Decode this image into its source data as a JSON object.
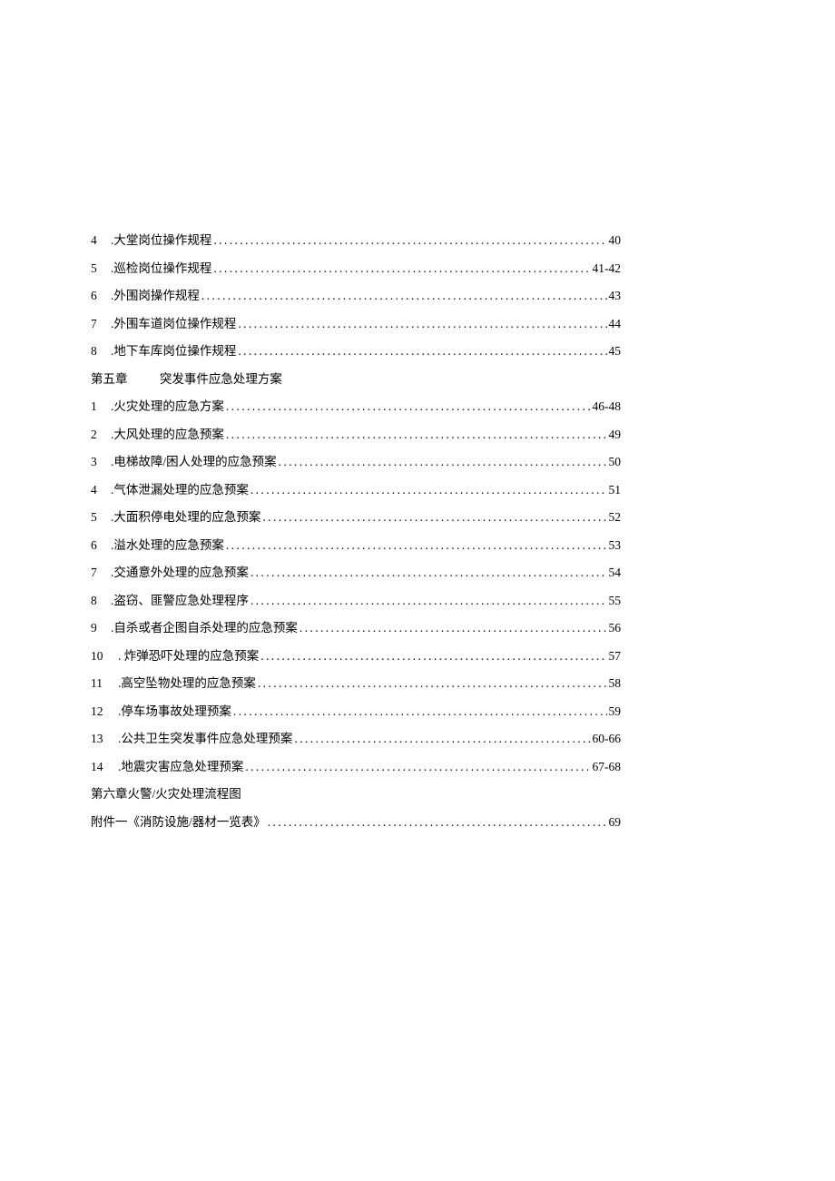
{
  "section_prev": [
    {
      "num": "4",
      "title": ".大堂岗位操作规程",
      "page": "40"
    },
    {
      "num": "5",
      "title": ".巡检岗位操作规程",
      "page": "41-42"
    },
    {
      "num": "6",
      "title": ".外围岗操作规程",
      "page": "43"
    },
    {
      "num": "7",
      "title": ".外围车道岗位操作规程",
      "page": "44"
    },
    {
      "num": "8",
      "title": ".地下车库岗位操作规程",
      "page": "45"
    }
  ],
  "chapter5": {
    "label": "第五章",
    "title": "突发事件应急处理方案",
    "items": [
      {
        "num": "1",
        "title": ".火灾处理的应急方案",
        "page": "46-48"
      },
      {
        "num": "2",
        "title": ".大风处理的应急预案",
        "page": "49"
      },
      {
        "num": "3",
        "title": ".电梯故障/困人处理的应急预案",
        "page": "50"
      },
      {
        "num": "4",
        "title": ".气体泄漏处理的应急预案",
        "page": "51"
      },
      {
        "num": "5",
        "title": ".大面积停电处理的应急预案",
        "page": "52"
      },
      {
        "num": "6",
        "title": ".溢水处理的应急预案",
        "page": "53"
      },
      {
        "num": "7",
        "title": ".交通意外处理的应急预案",
        "page": "54"
      },
      {
        "num": "8",
        "title": ".盗窃、匪警应急处理程序",
        "page": "55"
      },
      {
        "num": "9",
        "title": ".自杀或者企图自杀处理的应急预案",
        "page": "56"
      },
      {
        "num": "10",
        "title": ". 炸弹恐吓处理的应急预案",
        "page": "57"
      },
      {
        "num": "11",
        "title": ".高空坠物处理的应急预案",
        "page": "58"
      },
      {
        "num": "12",
        "title": ".停车场事故处理预案",
        "page": "59"
      },
      {
        "num": "13",
        "title": ".公共卫生突发事件应急处理预案",
        "page": "60-66"
      },
      {
        "num": "14",
        "title": ".地震灾害应急处理预案",
        "page": "67-68"
      }
    ]
  },
  "chapter6": {
    "heading": "第六章火警/火灾处理流程图"
  },
  "appendix": {
    "title": "附件一《消防设施/器材一览表》",
    "page": "69"
  }
}
